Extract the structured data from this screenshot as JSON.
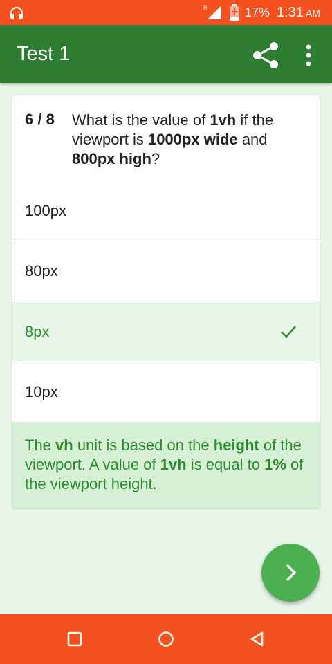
{
  "status_bar": {
    "battery_pct": "17%",
    "time": "1:31",
    "ampm": "AM",
    "roaming": "R"
  },
  "app_bar": {
    "title": "Test 1"
  },
  "question": {
    "number": "6 / 8",
    "text_parts": [
      "What is the value of ",
      "1vh",
      " if the viewport is ",
      "1000px wide",
      " and ",
      "800px high",
      "?"
    ]
  },
  "options": [
    {
      "label": "100px",
      "state": "normal"
    },
    {
      "label": "80px",
      "state": "normal"
    },
    {
      "label": "8px",
      "state": "correct"
    },
    {
      "label": "10px",
      "state": "normal"
    }
  ],
  "explanation_parts": [
    "The ",
    "vh",
    " unit is based on the ",
    "height",
    " of the viewport. A value of ",
    "1vh",
    " is equal to ",
    "1%",
    " of the viewport height."
  ],
  "colors": {
    "status_bar": "#F4511E",
    "app_bar": "#2E7D32",
    "correct_text": "#2E8B2E",
    "fab": "#4CAF50",
    "background": "#E8F5E9"
  },
  "icons": {
    "share": "share-icon",
    "more": "more-vert-icon",
    "next": "chevron-right-icon",
    "check": "check-icon"
  }
}
